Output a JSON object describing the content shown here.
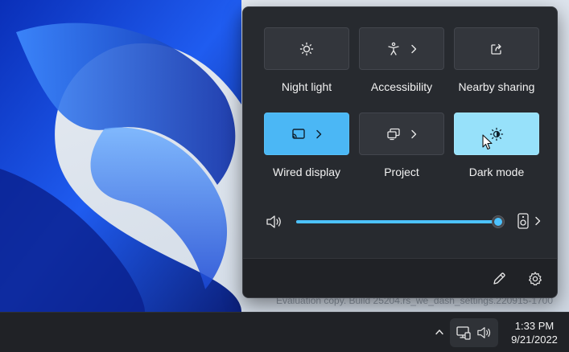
{
  "desktop": {
    "watermark": "Evaluation copy. Build 25204.rs_we_dash_settings.220915-1700"
  },
  "quick_settings": {
    "tiles": [
      {
        "label": "Night light",
        "icon": "night-light-icon",
        "has_chevron": false,
        "state": "off"
      },
      {
        "label": "Accessibility",
        "icon": "accessibility-icon",
        "has_chevron": true,
        "state": "off"
      },
      {
        "label": "Nearby sharing",
        "icon": "nearby-sharing-icon",
        "has_chevron": false,
        "state": "off"
      },
      {
        "label": "Wired display",
        "icon": "wired-display-icon",
        "has_chevron": true,
        "state": "on"
      },
      {
        "label": "Project",
        "icon": "project-icon",
        "has_chevron": true,
        "state": "off"
      },
      {
        "label": "Dark mode",
        "icon": "dark-mode-icon",
        "has_chevron": false,
        "state": "on"
      }
    ],
    "volume": {
      "level": 0.99,
      "icon": "speaker-icon",
      "output_icon": "speaker-device-icon"
    },
    "footer": {
      "edit_icon": "pencil-icon",
      "settings_icon": "gear-icon"
    }
  },
  "taskbar": {
    "time": "1:33 PM",
    "date": "9/21/2022",
    "tray_icons": [
      "network-icon",
      "speaker-icon"
    ]
  },
  "colors": {
    "accent": "#4cc2ff",
    "wired_display_active": "#4bb7f5",
    "dark_mode_active": "#97e1fa",
    "panel_bg": "#272a2f",
    "tile_bg": "#33363c",
    "taskbar_bg": "#202226"
  }
}
